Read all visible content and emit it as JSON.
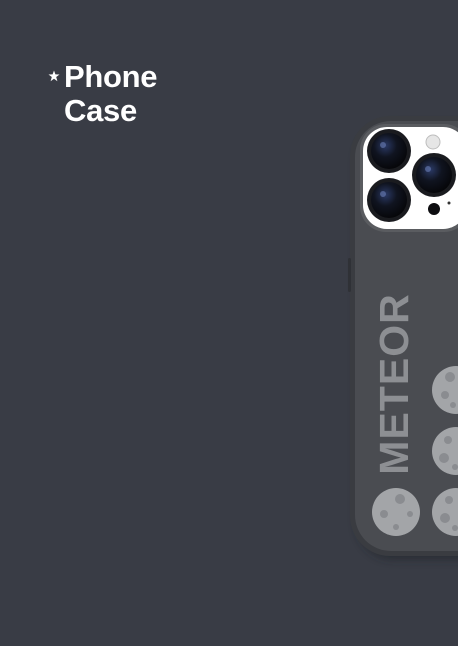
{
  "header": {
    "star_icon": "star-icon",
    "title_line_1": "Phone",
    "title_line_2": "Case"
  },
  "product": {
    "brand_text": "METEOR",
    "case_color": "#4a4c51",
    "background_color": "#393c45"
  }
}
